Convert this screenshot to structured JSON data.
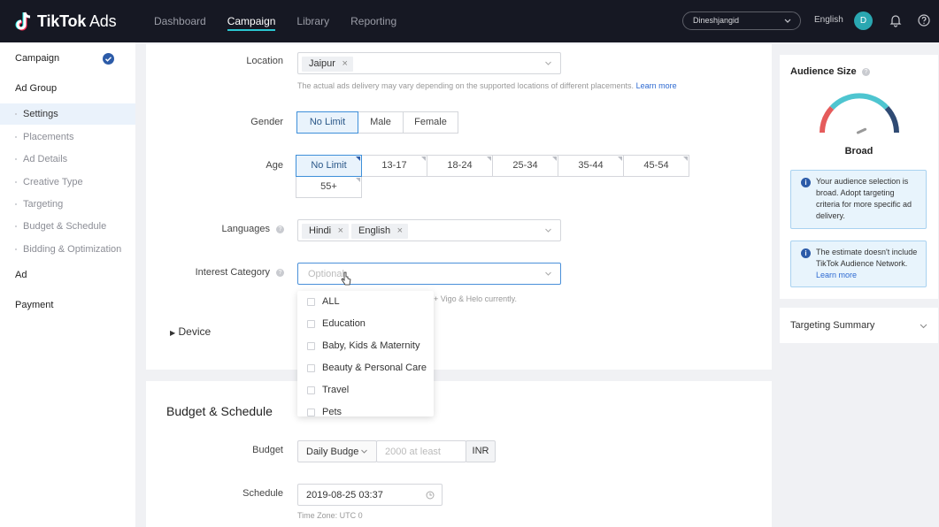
{
  "brand": {
    "name": "TikTok",
    "suffix": " Ads"
  },
  "nav": {
    "items": [
      "Dashboard",
      "Campaign",
      "Library",
      "Reporting"
    ],
    "active": "Campaign"
  },
  "account": {
    "name": "Dineshjangid",
    "language": "English",
    "avatar": "D"
  },
  "sidebar": {
    "campaign": "Campaign",
    "ad_group": "Ad Group",
    "items": [
      "Settings",
      "Placements",
      "Ad Details",
      "Creative Type",
      "Targeting",
      "Budget & Schedule",
      "Bidding & Optimization"
    ],
    "ad": "Ad",
    "payment": "Payment"
  },
  "form": {
    "location": {
      "label": "Location",
      "tags": [
        "Jaipur"
      ],
      "hint": "The actual ads delivery may vary depending on the supported locations of different placements.",
      "hint_link": "Learn more"
    },
    "gender": {
      "label": "Gender",
      "options": [
        "No Limit",
        "Male",
        "Female"
      ],
      "selected": "No Limit"
    },
    "age": {
      "label": "Age",
      "options": [
        "No Limit",
        "13-17",
        "18-24",
        "25-34",
        "35-44",
        "45-54",
        "55+"
      ],
      "selected": "No Limit"
    },
    "languages": {
      "label": "Languages",
      "tags": [
        "Hindi",
        "English"
      ]
    },
    "interest": {
      "label": "Interest Category",
      "placeholder": "Optional",
      "hint_partial": "+ Vigo & Helo currently."
    },
    "device": {
      "label": "Device"
    }
  },
  "interest_dropdown": [
    "ALL",
    "Education",
    "Baby, Kids & Maternity",
    "Beauty & Personal Care",
    "Travel",
    "Pets"
  ],
  "budget_schedule": {
    "title": "Budget & Schedule",
    "budget_label": "Budget",
    "budget_type": "Daily Budge",
    "budget_placeholder": "2000 at least",
    "currency": "INR",
    "schedule_label": "Schedule",
    "schedule_value": "2019-08-25 03:37",
    "timezone": "Time Zone: UTC 0"
  },
  "audience": {
    "title": "Audience Size",
    "level": "Broad",
    "gauge_fraction": 0.62,
    "notice1": "Your audience selection is broad. Adopt targeting criteria for more specific ad delivery.",
    "notice2_text": "The estimate doesn't include TikTok Audience Network.",
    "notice2_link": "Learn more"
  },
  "targeting_summary": {
    "title": "Targeting Summary"
  },
  "colors": {
    "topbar": "#161823",
    "accent": "#2bc6d1",
    "primary": "#2c5ba8",
    "link": "#2e6ad1"
  }
}
